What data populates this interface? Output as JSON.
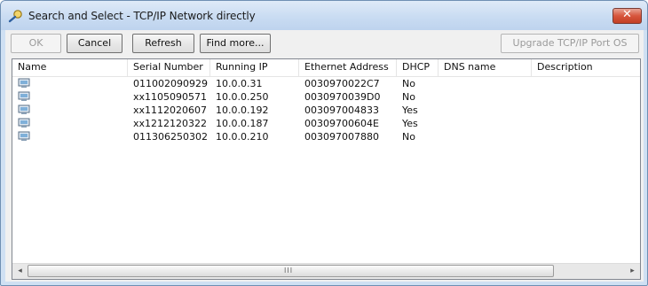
{
  "window": {
    "title": "Search and Select - TCP/IP Network directly",
    "close_glyph": "✕",
    "close_color": "#c94a33"
  },
  "toolbar": {
    "ok_label": "OK",
    "cancel_label": "Cancel",
    "refresh_label": "Refresh",
    "find_more_label": "Find more...",
    "upgrade_label": "Upgrade TCP/IP Port OS"
  },
  "table": {
    "columns": [
      "Name",
      "Serial Number",
      "Running IP",
      "Ethernet Address",
      "DHCP",
      "DNS name",
      "Description"
    ],
    "rows": [
      {
        "name": "",
        "serial": "011002090929",
        "ip": "10.0.0.31",
        "eth": "0030970022C7",
        "dhcp": "No",
        "dns": "",
        "desc": ""
      },
      {
        "name": "",
        "serial": "xx1105090571",
        "ip": "10.0.0.250",
        "eth": "0030970039D0",
        "dhcp": "No",
        "dns": "",
        "desc": ""
      },
      {
        "name": "",
        "serial": "xx1112020607",
        "ip": "10.0.0.192",
        "eth": "003097004833",
        "dhcp": "Yes",
        "dns": "",
        "desc": ""
      },
      {
        "name": "",
        "serial": "xx1212120322",
        "ip": "10.0.0.187",
        "eth": "00309700604E",
        "dhcp": "Yes",
        "dns": "",
        "desc": ""
      },
      {
        "name": "",
        "serial": "011306250302",
        "ip": "10.0.0.210",
        "eth": "003097007880",
        "dhcp": "No",
        "dns": "",
        "desc": ""
      }
    ]
  },
  "scrollbar": {
    "left_arrow": "◂",
    "right_arrow": "▸",
    "grip": "III"
  }
}
